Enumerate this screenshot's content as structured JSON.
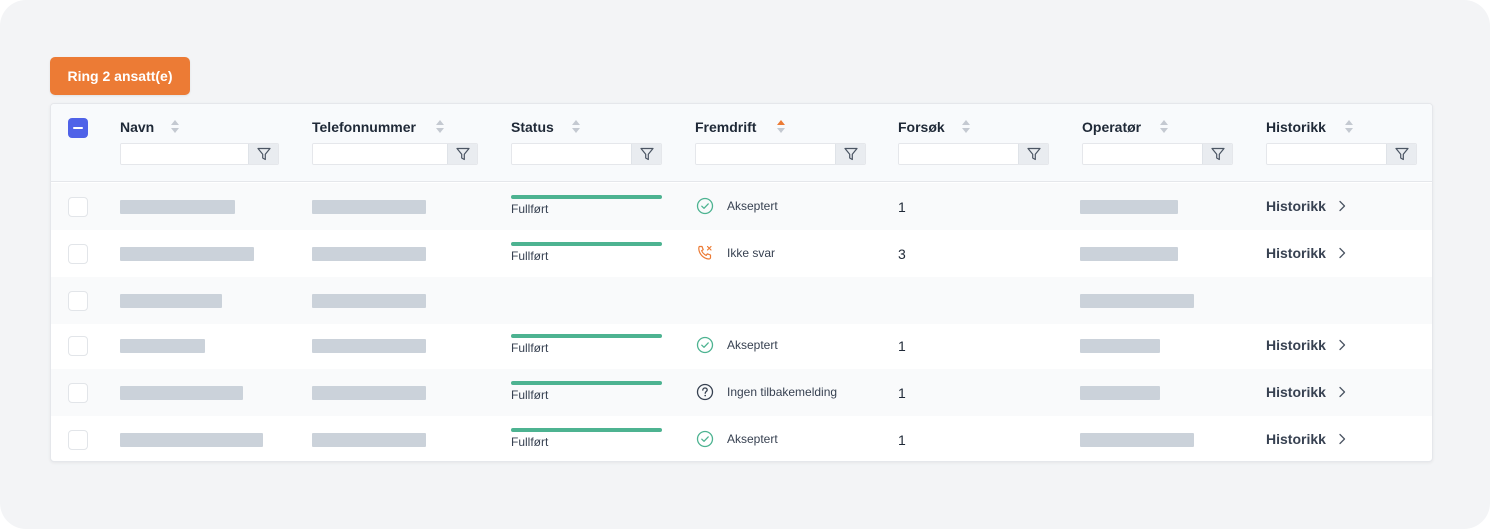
{
  "toolbar": {
    "ring_label": "Ring 2 ansatt(e)"
  },
  "columns": [
    {
      "label": "Navn",
      "sort": "none"
    },
    {
      "label": "Telefonnummer",
      "sort": "none"
    },
    {
      "label": "Status",
      "sort": "none"
    },
    {
      "label": "Fremdrift",
      "sort": "ascending"
    },
    {
      "label": "Forsøk",
      "sort": "none"
    },
    {
      "label": "Operatør",
      "sort": "none"
    },
    {
      "label": "Historikk",
      "sort": "none"
    }
  ],
  "rows": [
    {
      "status": "Fullført",
      "progress": "Akseptert",
      "progress_icon": "check-circle-icon",
      "attempts": "1",
      "history": "Historikk"
    },
    {
      "status": "Fullført",
      "progress": "Ikke svar",
      "progress_icon": "phone-missed-icon",
      "attempts": "3",
      "history": "Historikk"
    },
    {
      "status": "",
      "progress": "",
      "progress_icon": "",
      "attempts": "",
      "history": ""
    },
    {
      "status": "Fullført",
      "progress": "Akseptert",
      "progress_icon": "check-circle-icon",
      "attempts": "1",
      "history": "Historikk"
    },
    {
      "status": "Fullført",
      "progress": "Ingen tilbakemelding",
      "progress_icon": "question-circle-icon",
      "attempts": "1",
      "history": "Historikk"
    },
    {
      "status": "Fullført",
      "progress": "Akseptert",
      "progress_icon": "check-circle-icon",
      "attempts": "1",
      "history": "Historikk"
    }
  ],
  "colors": {
    "accent": "#ec7b35",
    "checkbox": "#4f62e8",
    "status_bar": "#4db391",
    "placeholder": "#cbd2da"
  }
}
